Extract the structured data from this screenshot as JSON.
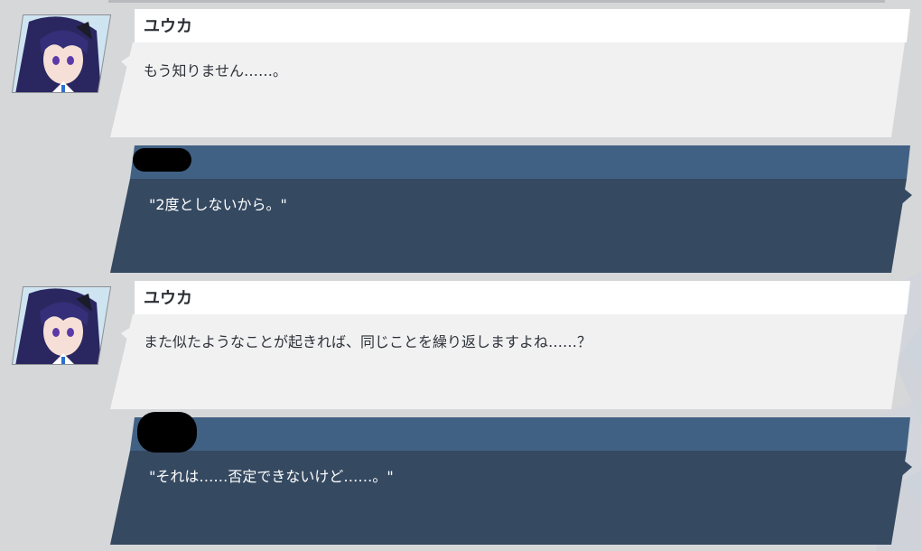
{
  "messages": [
    {
      "speaker": "ユウカ",
      "text": "もう知りません……。"
    },
    {
      "reply": "\"2度としないから。\""
    },
    {
      "speaker": "ユウカ",
      "text": "また似たようなことが起きれば、同じことを繰り返しますよね……？"
    },
    {
      "reply": "\"それは……否定できないけど……。\""
    }
  ],
  "colors": {
    "npc_bubble": "#f1f1f1",
    "player_bubble_header": "#416184",
    "player_bubble_body": "#354961",
    "background": "#d6d7d9"
  },
  "icons": [
    "character-portrait-yuuka",
    "redacted-name"
  ]
}
